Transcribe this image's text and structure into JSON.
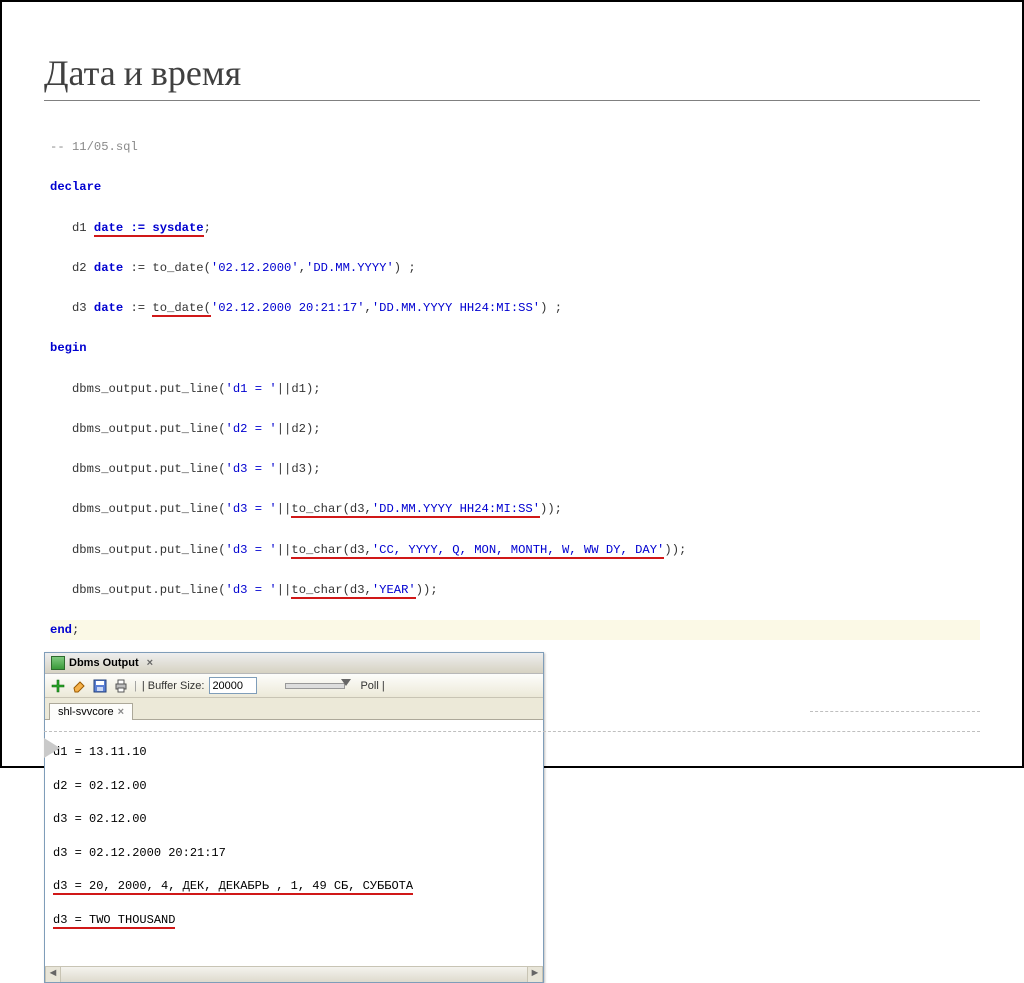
{
  "slide": {
    "title": "Дата и время"
  },
  "code": {
    "l1": "-- 11/05.sql",
    "l2a": "declare",
    "l3": {
      "p": "   d1 ",
      "u": "date := sysdate",
      "s": ";"
    },
    "l4": {
      "p": "   d2 ",
      "k": "date",
      "m": " := to_date(",
      "s1": "'02.12.2000'",
      "c": ",",
      "s2": "'DD.MM.YYYY'",
      "e": ") ;"
    },
    "l5": {
      "p": "   d3 ",
      "k": "date",
      "m": " := ",
      "u": "to_date(",
      "s1": "'02.12.2000 20:21:17'",
      "c": ",",
      "s2": "'DD.MM.YYYY HH24:MI:SS'",
      "e": ") ;"
    },
    "l6": "begin",
    "l7": {
      "p": "   dbms_output.put_line(",
      "s": "'d1 = '",
      "e": "||d1);"
    },
    "l8": {
      "p": "   dbms_output.put_line(",
      "s": "'d2 = '",
      "e": "||d2);"
    },
    "l9": {
      "p": "   dbms_output.put_line(",
      "s": "'d3 = '",
      "e": "||d3);"
    },
    "l10": {
      "p": "   dbms_output.put_line(",
      "s": "'d3 = '",
      "m": "||",
      "u": "to_char(d3,",
      "s2": "'DD.MM.YYYY HH24:MI:SS'",
      "e": "));"
    },
    "l11": {
      "p": "   dbms_output.put_line(",
      "s": "'d3 = '",
      "m": "||",
      "u": "to_char(d3,",
      "s2": "'CC, YYYY, Q, MON, MONTH, W, WW DY, DAY'",
      "e": "));"
    },
    "l12": {
      "p": "   dbms_output.put_line(",
      "s": "'d3 = '",
      "m": "||",
      "u": "to_char(d3,",
      "s2": "'YEAR'",
      "e": "));"
    },
    "l13": "end",
    "l13s": ";"
  },
  "panel": {
    "title": "Dbms Output",
    "buffer_label": "| Buffer Size:",
    "buffer_value": "20000",
    "poll_label": "Poll |",
    "tab": "shl-svvcore",
    "output": [
      "d1 = 13.11.10",
      "d2 = 02.12.00",
      "d3 = 02.12.00",
      "d3 = 02.12.2000 20:21:17",
      "d3 = 20, 2000, 4, ДЕК, ДЕКАБРЬ , 1, 49 СБ, СУББОТА",
      "d3 = TWO THOUSAND"
    ]
  }
}
